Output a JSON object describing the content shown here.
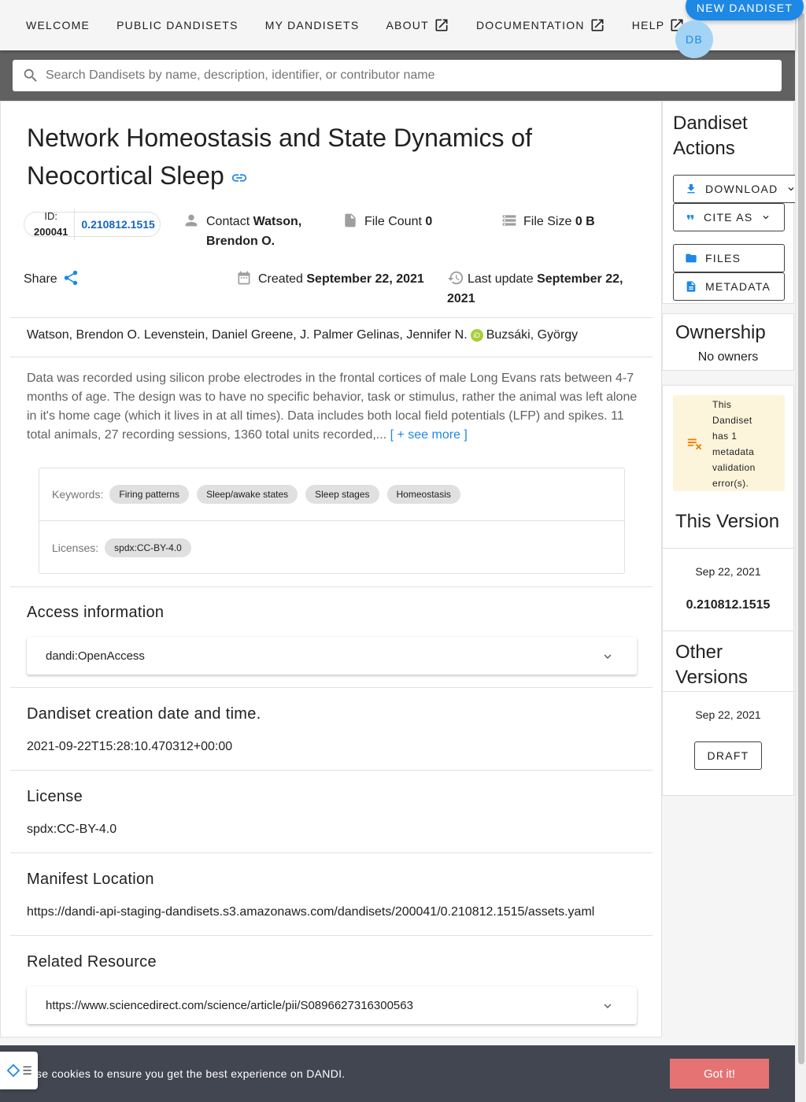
{
  "nav": {
    "items": [
      "Welcome",
      "Public Dandisets",
      "My Dandisets",
      "About",
      "Documentation",
      "Help"
    ],
    "new_dandiset": "NEW DANDISET",
    "avatar_initials": "DB"
  },
  "search": {
    "placeholder": "Search Dandisets by name, description, identifier, or contributor name"
  },
  "dandiset": {
    "title": "Network Homeostasis and State Dynamics of Neocortical Sleep",
    "id_label": "ID:",
    "id": "200041",
    "version": "0.210812.1515",
    "contact_label": "Contact",
    "contact": "Watson, Brendon O.",
    "file_count_label": "File Count",
    "file_count": "0",
    "file_size_label": "File Size",
    "file_size": "0 B",
    "share_label": "Share",
    "created_label": "Created",
    "created": "September 22, 2021",
    "updated_label": "Last update",
    "updated": "September 22, 2021",
    "authors_before_orcid": "Watson, Brendon O. Levenstein, Daniel Greene, J. Palmer Gelinas, Jennifer N.",
    "authors_after_orcid": "Buzsáki, György",
    "description": "Data was recorded using silicon probe electrodes in the frontal cortices of male Long Evans rats between 4-7 months of age. The design was to have no specific behavior, task or stimulus, rather the animal was left alone in it's home cage (which it lives in at all times). Data includes both local field potentials (LFP) and spikes. 11 total animals, 27 recording sessions, 1360 total units recorded,...",
    "see_more": "[ + see more ]",
    "keywords_label": "Keywords:",
    "keywords": [
      "Firing patterns",
      "Sleep/awake states",
      "Sleep stages",
      "Homeostasis"
    ],
    "licenses_label": "Licenses:",
    "license_chip": "spdx:CC-BY-4.0"
  },
  "sections": {
    "access": {
      "heading": "Access information",
      "value": "dandi:OpenAccess"
    },
    "creation": {
      "heading": "Dandiset creation date and time.",
      "value": "2021-09-22T15:28:10.470312+00:00"
    },
    "license": {
      "heading": "License",
      "value": "spdx:CC-BY-4.0"
    },
    "manifest": {
      "heading": "Manifest Location",
      "value": "https://dandi-api-staging-dandisets.s3.amazonaws.com/dandisets/200041/0.210812.1515/assets.yaml"
    },
    "related": {
      "heading": "Related Resource",
      "value": "https://www.sciencedirect.com/science/article/pii/S0896627316300563"
    }
  },
  "sidebar": {
    "actions_title": "Dandiset Actions",
    "download": "DOWNLOAD",
    "cite_as": "CITE AS",
    "files": "FILES",
    "metadata": "METADATA",
    "ownership_title": "Ownership",
    "owners": "No owners",
    "validation_warning": "This Dandiset has 1 metadata validation error(s).",
    "this_version_title": "This Version",
    "this_version_date": "Sep 22, 2021",
    "this_version": "0.210812.1515",
    "other_versions_title": "Other Versions",
    "other_version_date": "Sep 22, 2021",
    "draft": "DRAFT"
  },
  "cookie": {
    "text": "se cookies to ensure you get the best experience on DANDI.",
    "button": "Got it!"
  },
  "colors": {
    "primary": "#1e88e5",
    "nav_bg": "#f5f5f5",
    "search_band": "#616161",
    "cookie_bg": "#424650",
    "cookie_button": "#e57373",
    "warning_bg": "#fdf4dc",
    "warning_icon": "#f57c00"
  }
}
